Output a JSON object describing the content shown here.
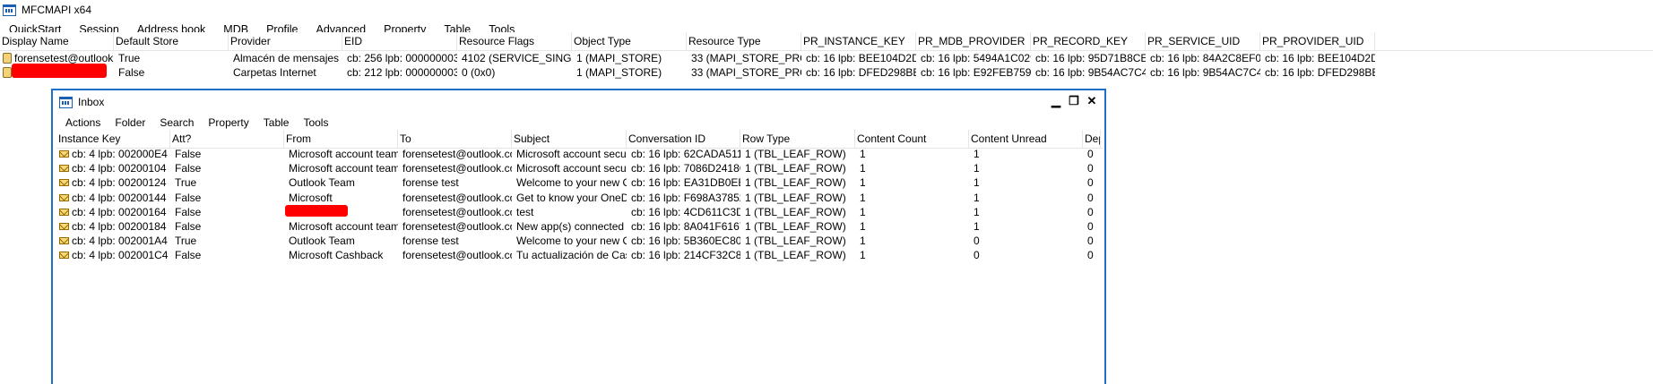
{
  "app": {
    "title": "MFCMAPI x64",
    "menu": [
      "QuickStart",
      "Session",
      "Address book",
      "MDB",
      "Profile",
      "Advanced",
      "Property",
      "Table",
      "Tools"
    ]
  },
  "stores": {
    "columns": [
      "Display Name",
      "Default Store",
      "Provider",
      "EID",
      "Resource Flags",
      "Object Type",
      "Resource Type",
      "PR_INSTANCE_KEY",
      "PR_MDB_PROVIDER",
      "PR_RECORD_KEY",
      "PR_SERVICE_UID",
      "PR_PROVIDER_UID"
    ],
    "rows": [
      [
        "forensetest@outlook....",
        "True",
        "Almacén de mensajes d...",
        "cb: 256 lpb: 0000000038...",
        "4102 (SERVICE_SINGLE_...",
        "1 (MAPI_STORE)",
        "33 (MAPI_STORE_PROVI...",
        "cb: 16 lpb: BEE104D2DD...",
        "cb: 16 lpb: 5494A1C0297...",
        "cb: 16 lpb: 95D71B8CED...",
        "cb: 16 lpb: 84A2C8EF01F...",
        "cb: 16 lpb: BEE104D2DD..."
      ],
      [
        "",
        "False",
        "Carpetas Internet",
        "cb: 212 lpb: 0000000038...",
        "0 (0x0)",
        "1 (MAPI_STORE)",
        "33 (MAPI_STORE_PROVI...",
        "cb: 16 lpb: DFED298BEC...",
        "cb: 16 lpb: E92FEB75965...",
        "cb: 16 lpb: 9B54AC7C42...",
        "cb: 16 lpb: 9B54AC7C42...",
        "cb: 16 lpb: DFED298BEC..."
      ]
    ]
  },
  "inbox": {
    "title": "Inbox",
    "controls": {
      "minimize": "▁",
      "restore": "❐",
      "close": "✕"
    },
    "menu": [
      "Actions",
      "Folder",
      "Search",
      "Property",
      "Table",
      "Tools"
    ],
    "columns": [
      "Instance Key",
      "Att?",
      "From",
      "To",
      "Subject",
      "Conversation ID",
      "Row Type",
      "Content Count",
      "Content Unread",
      "Dep"
    ],
    "rows": [
      [
        "cb: 4 lpb: 002000E4",
        "False",
        "Microsoft account team",
        "forensetest@outlook.com",
        "Microsoft account secur...",
        "cb: 16 lpb: 62CADA5114...",
        "1 (TBL_LEAF_ROW)",
        "1",
        "1",
        "0"
      ],
      [
        "cb: 4 lpb: 00200104",
        "False",
        "Microsoft account team",
        "forensetest@outlook.com",
        "Microsoft account secur...",
        "cb: 16 lpb: 7086D2418C4...",
        "1 (TBL_LEAF_ROW)",
        "1",
        "1",
        "0"
      ],
      [
        "cb: 4 lpb: 00200124",
        "True",
        "Outlook Team",
        "forense test",
        "Welcome to your new O...",
        "cb: 16 lpb: EA31DB0EE4...",
        "1 (TBL_LEAF_ROW)",
        "1",
        "1",
        "0"
      ],
      [
        "cb: 4 lpb: 00200144",
        "False",
        "Microsoft",
        "forensetest@outlook.com",
        "Get to know your OneDr...",
        "cb: 16 lpb: F698A378528...",
        "1 (TBL_LEAF_ROW)",
        "1",
        "1",
        "0"
      ],
      [
        "cb: 4 lpb: 00200164",
        "False",
        "",
        "forensetest@outlook.com",
        "test",
        "cb: 16 lpb: 4CD611C3D4...",
        "1 (TBL_LEAF_ROW)",
        "1",
        "1",
        "0"
      ],
      [
        "cb: 4 lpb: 00200184",
        "False",
        "Microsoft account team",
        "forensetest@outlook.com",
        "New app(s) connected t...",
        "cb: 16 lpb: 8A041F61679...",
        "1 (TBL_LEAF_ROW)",
        "1",
        "1",
        "0"
      ],
      [
        "cb: 4 lpb: 002001A4",
        "True",
        "Outlook Team",
        "forense test",
        "Welcome to your new O...",
        "cb: 16 lpb: 5B360EC8027...",
        "1 (TBL_LEAF_ROW)",
        "1",
        "0",
        "0"
      ],
      [
        "cb: 4 lpb: 002001C4",
        "False",
        "Microsoft Cashback",
        "forensetest@outlook.com",
        "Tu actualización de Cas...",
        "cb: 16 lpb: 214CF32C86B...",
        "1 (TBL_LEAF_ROW)",
        "1",
        "0",
        "0"
      ]
    ]
  },
  "colors": {
    "accent": "#1e70c8",
    "redaction": "#ff0000",
    "grid": "#e5e5e5"
  },
  "icons": {
    "app": "app-window-icon",
    "store": "message-store-icon",
    "message": "envelope-icon"
  }
}
